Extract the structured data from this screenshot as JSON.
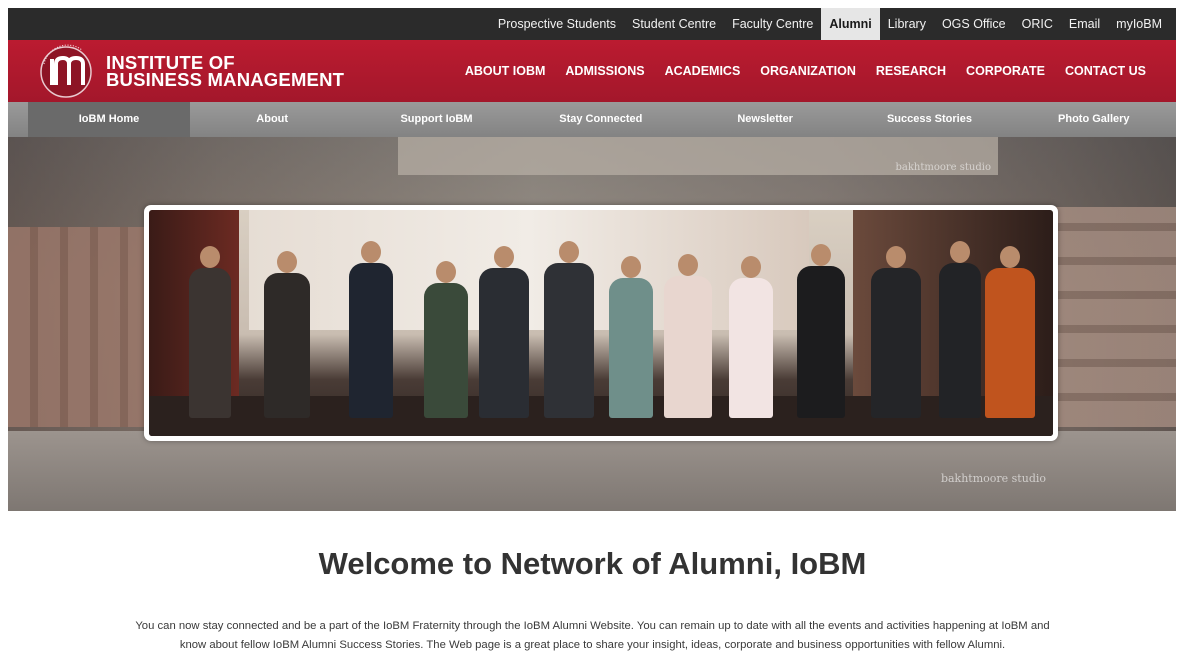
{
  "topbar": {
    "links": [
      "Prospective Students",
      "Student Centre",
      "Faculty Centre",
      "Alumni",
      "Library",
      "OGS Office",
      "ORIC",
      "Email",
      "myIoBM"
    ],
    "active": "Alumni"
  },
  "header": {
    "logo_line1": "INSTITUTE OF",
    "logo_line2": "BUSINESS MANAGEMENT",
    "nav": [
      "ABOUT IOBM",
      "ADMISSIONS",
      "ACADEMICS",
      "ORGANIZATION",
      "RESEARCH",
      "CORPORATE",
      "CONTACT US"
    ]
  },
  "subnav": {
    "items": [
      "IoBM Home",
      "About",
      "Support IoBM",
      "Stay Connected",
      "Newsletter",
      "Success Stories",
      "Photo Gallery"
    ],
    "active": "IoBM Home"
  },
  "hero": {
    "watermark_top": "bakhtmoore studio",
    "watermark_bottom": "bakhtmoore studio"
  },
  "content": {
    "title": "Welcome to Network of Alumni, IoBM",
    "intro_line1": "You can now stay connected and be a part of the IoBM Fraternity through the IoBM Alumni Website. You can remain up to date with all the events and activities happening at IoBM and",
    "intro_line2": "know about fellow IoBM Alumni Success Stories. The Web page is a great place to share your insight, ideas, corporate and business opportunities with fellow Alumni."
  },
  "colors": {
    "brand_red": "#b01a2e",
    "topbar_bg": "#2b2b2b",
    "subnav_bg": "#8c8c8c"
  }
}
